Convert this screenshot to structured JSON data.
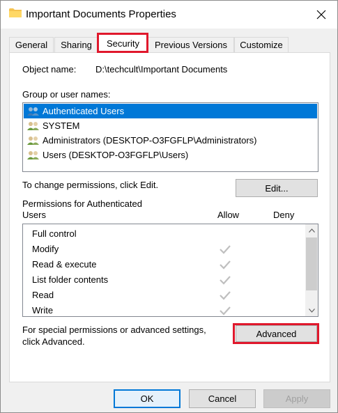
{
  "window": {
    "title": "Important Documents Properties",
    "close_glyph": "×"
  },
  "tabs": [
    {
      "label": "General"
    },
    {
      "label": "Sharing"
    },
    {
      "label": "Security"
    },
    {
      "label": "Previous Versions"
    },
    {
      "label": "Customize"
    }
  ],
  "active_tab": "Security",
  "security": {
    "object_name_label": "Object name:",
    "object_name_value": "D:\\techcult\\Important Documents",
    "group_label": "Group or user names:",
    "users": [
      {
        "name": "Authenticated Users",
        "selected": true
      },
      {
        "name": "SYSTEM",
        "selected": false
      },
      {
        "name": "Administrators (DESKTOP-O3FGFLP\\Administrators)",
        "selected": false
      },
      {
        "name": "Users (DESKTOP-O3FGFLP\\Users)",
        "selected": false
      }
    ],
    "change_text": "To change permissions, click Edit.",
    "edit_button": "Edit...",
    "perm_header_line1": "Permissions for Authenticated",
    "perm_header_line2": "Users",
    "allow_header": "Allow",
    "deny_header": "Deny",
    "permissions": [
      {
        "name": "Full control",
        "allow": false,
        "deny": false
      },
      {
        "name": "Modify",
        "allow": true,
        "deny": false
      },
      {
        "name": "Read & execute",
        "allow": true,
        "deny": false
      },
      {
        "name": "List folder contents",
        "allow": true,
        "deny": false
      },
      {
        "name": "Read",
        "allow": true,
        "deny": false
      },
      {
        "name": "Write",
        "allow": true,
        "deny": false
      }
    ],
    "advanced_text_line1": "For special permissions or advanced settings,",
    "advanced_text_line2": "click Advanced.",
    "advanced_button": "Advanced"
  },
  "footer": {
    "ok": "OK",
    "cancel": "Cancel",
    "apply": "Apply"
  },
  "colors": {
    "highlight_red": "#e0182c",
    "selection_blue": "#0078d7",
    "check_gray": "#bfbfbf"
  }
}
